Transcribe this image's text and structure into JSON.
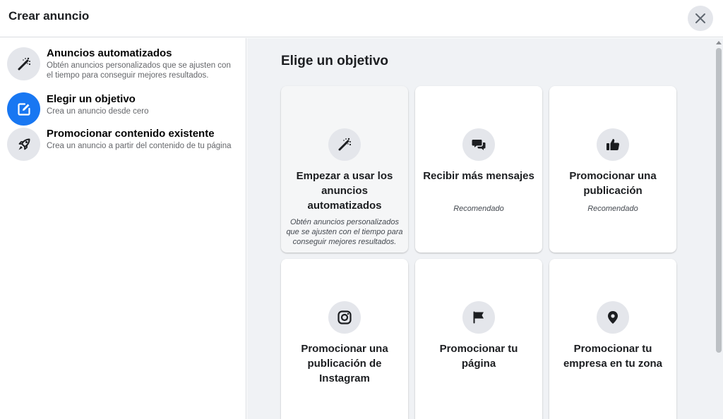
{
  "header": {
    "title": "Crear anuncio"
  },
  "sidebar": {
    "items": [
      {
        "title": "Anuncios automatizados",
        "description": "Obtén anuncios personalizados que se ajusten con el tiempo para conseguir mejores resultados.",
        "icon": "magic-wand-icon",
        "active": false
      },
      {
        "title": "Elegir un objetivo",
        "description": "Crea un anuncio desde cero",
        "icon": "edit-icon",
        "active": true
      },
      {
        "title": "Promocionar contenido existente",
        "description": "Crea un anuncio a partir del contenido de tu página",
        "icon": "rocket-icon",
        "active": false
      }
    ]
  },
  "main": {
    "title": "Elige un objetivo",
    "cards": [
      {
        "title": "Empezar a usar los anuncios automatizados",
        "subtitle": "Obtén anuncios personalizados que se ajusten con el tiempo para conseguir mejores resultados.",
        "icon": "magic-wand-icon"
      },
      {
        "title": "Recibir más mensajes",
        "subtitle": "Recomendado",
        "icon": "chat-bubbles-icon"
      },
      {
        "title": "Promocionar una publicación",
        "subtitle": "Recomendado",
        "icon": "thumbs-up-icon"
      },
      {
        "title": "Promocionar una publicación de Instagram",
        "subtitle": "",
        "icon": "instagram-icon"
      },
      {
        "title": "Promocionar tu página",
        "subtitle": "",
        "icon": "flag-icon"
      },
      {
        "title": "Promocionar tu empresa en tu zona",
        "subtitle": "",
        "icon": "location-pin-icon"
      }
    ]
  },
  "colors": {
    "accent": "#1877f2",
    "icon_bg": "#e4e6eb",
    "panel_bg": "#f0f2f5"
  }
}
